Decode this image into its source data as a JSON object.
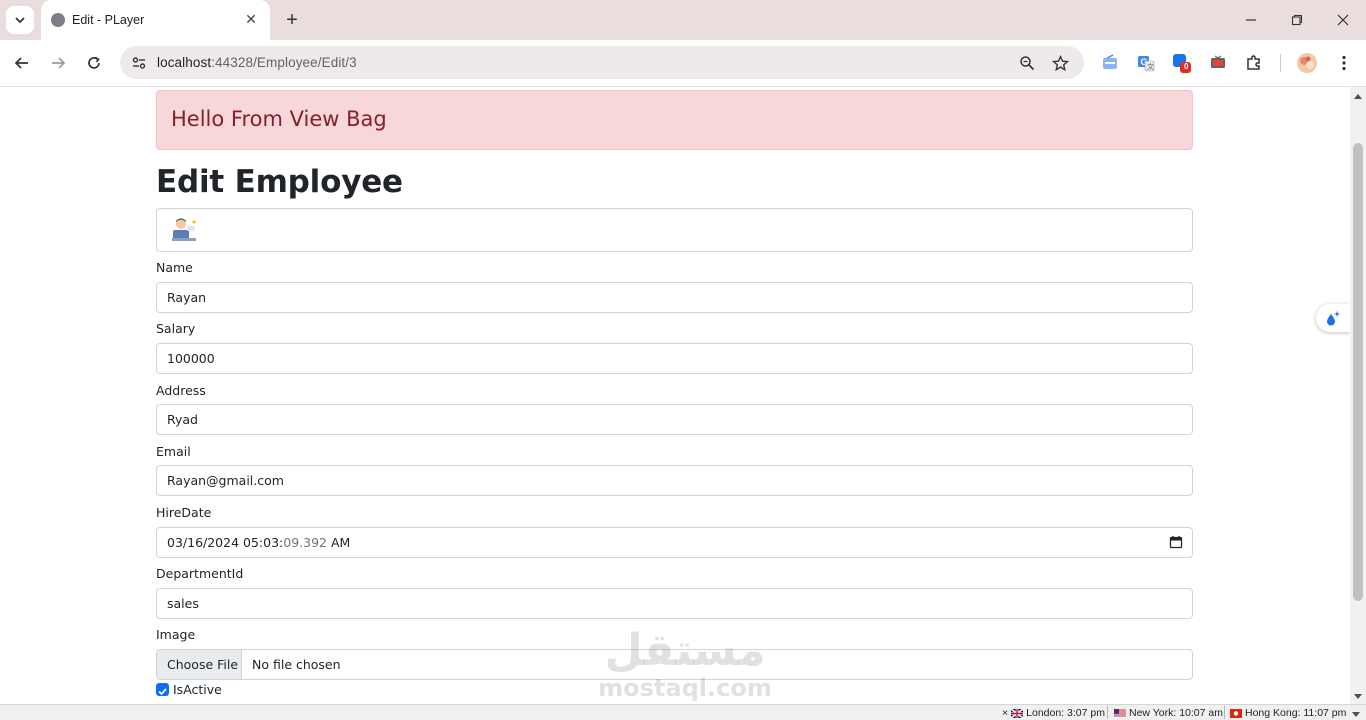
{
  "browser": {
    "tab_title": "Edit - PLayer",
    "url_host": "localhost",
    "url_rest": ":44328/Employee/Edit/3",
    "extension_badge": "0"
  },
  "page": {
    "alert_text": "Hello From View Bag",
    "heading": "Edit Employee",
    "fields": [
      {
        "label": "Name",
        "value": "Rayan"
      },
      {
        "label": "Salary",
        "value": "100000"
      },
      {
        "label": "Address",
        "value": "Ryad"
      },
      {
        "label": "Email",
        "value": "Rayan@gmail.com"
      }
    ],
    "hiredate": {
      "label": "HireDate",
      "value_main": "03/16/2024 05:03:",
      "value_dim": "09.392",
      "value_ampm": "AM"
    },
    "department": {
      "label": "DepartmentId",
      "value": "sales"
    },
    "image": {
      "label": "Image",
      "button": "Choose File",
      "status": "No file chosen"
    },
    "isactive": {
      "label": "IsActive",
      "checked": true
    }
  },
  "watermark": {
    "arabic": "مستقل",
    "latin": "mostaql.com"
  },
  "statusbar": {
    "close": "×",
    "clocks": [
      {
        "city": "London: 3:07 pm"
      },
      {
        "city": "New York: 10:07 am"
      },
      {
        "city": "Hong Kong: 11:07 pm"
      }
    ]
  }
}
